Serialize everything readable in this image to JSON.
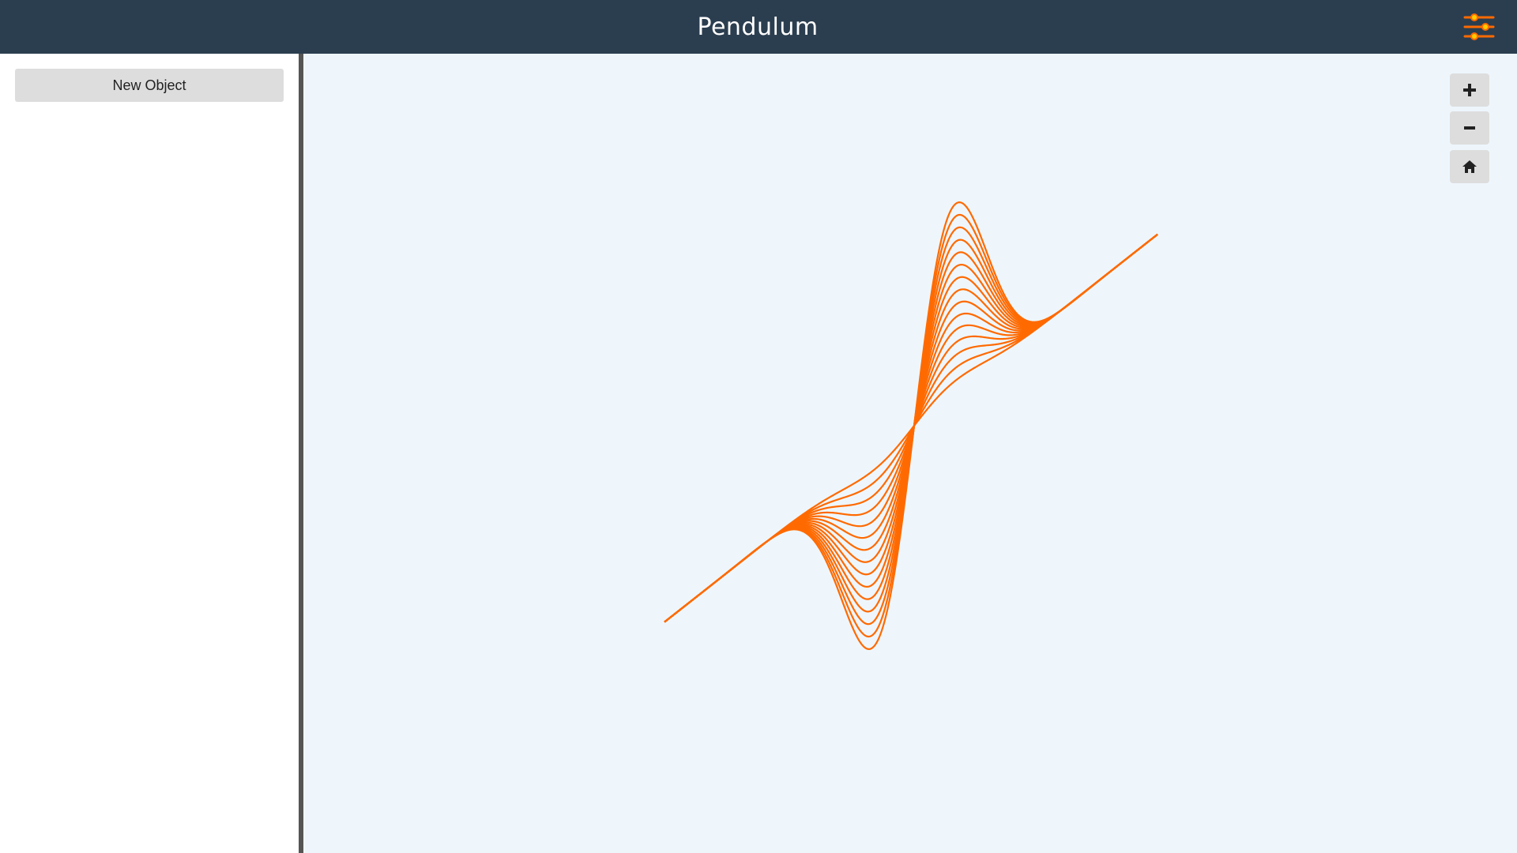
{
  "header": {
    "title": "Pendulum",
    "settings_icon": "sliders-icon"
  },
  "sidebar": {
    "new_object_label": "New Object"
  },
  "canvas": {
    "background": "#eef6fc",
    "curve_color": "#ff6a00",
    "curve_count": 15,
    "zoom_in_icon": "plus-icon",
    "zoom_out_icon": "minus-icon",
    "home_icon": "home-icon"
  },
  "colors": {
    "header_bg": "#2b3e50",
    "accent": "#ff6a00",
    "button_bg": "#dddddd",
    "divider": "#555555"
  }
}
